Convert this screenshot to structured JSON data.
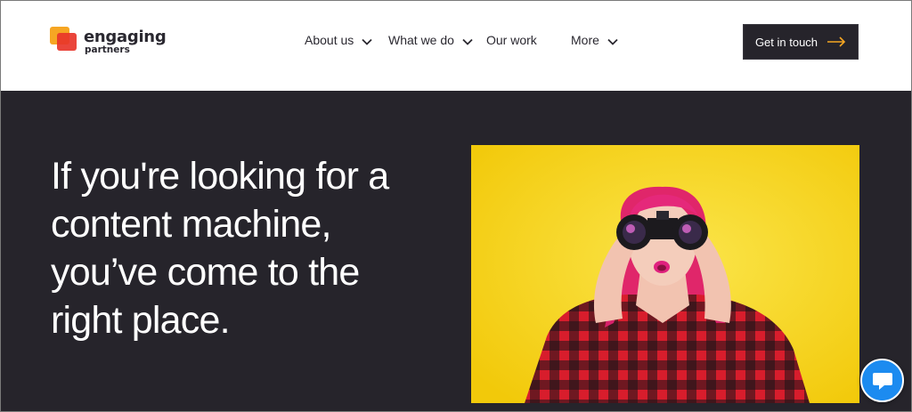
{
  "brand": {
    "name_main": "engaging",
    "name_sub": "partners",
    "logo_colors": [
      "#f47b20",
      "#e8352a"
    ]
  },
  "nav": {
    "items": [
      {
        "label": "About us",
        "has_dropdown": true
      },
      {
        "label": "What we do",
        "has_dropdown": true
      },
      {
        "label": "Our work",
        "has_dropdown": false
      },
      {
        "label": "More",
        "has_dropdown": true
      }
    ]
  },
  "cta": {
    "label": "Get in touch",
    "icon": "arrow-right-icon",
    "accent": "#f6a623"
  },
  "hero": {
    "title_lines": [
      "If you're looking for a",
      "content machine,",
      "you’ve come to the",
      "right place."
    ],
    "image_bg": "#f5d20e"
  },
  "chat": {
    "icon": "chat-bubble-icon",
    "color": "#1c8bf0"
  },
  "colors": {
    "header_bg": "#ffffff",
    "hero_bg": "#26242b",
    "text_dark": "#2a2830"
  }
}
